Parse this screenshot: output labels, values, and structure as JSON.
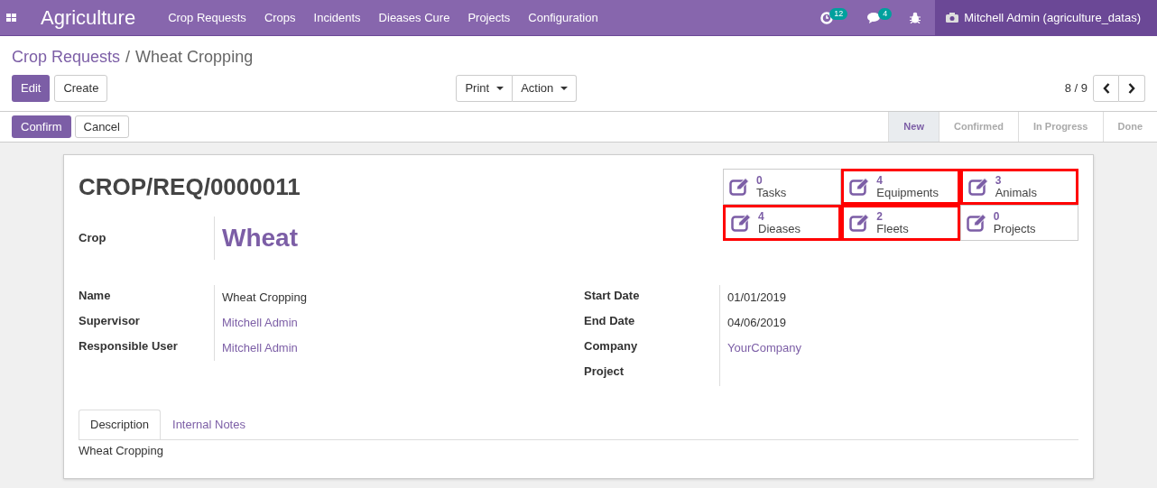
{
  "navbar": {
    "app_name": "Agriculture",
    "menu": [
      "Crop Requests",
      "Crops",
      "Incidents",
      "Dieases Cure",
      "Projects",
      "Configuration"
    ],
    "activity_count": "12",
    "message_count": "4",
    "user": "Mitchell Admin (agriculture_datas)"
  },
  "breadcrumb": {
    "parent": "Crop Requests",
    "separator": "/",
    "current": "Wheat Cropping"
  },
  "buttons": {
    "edit": "Edit",
    "create": "Create",
    "print": "Print",
    "action": "Action",
    "confirm": "Confirm",
    "cancel": "Cancel"
  },
  "pager": "8 / 9",
  "stages": [
    {
      "label": "New",
      "selected": true
    },
    {
      "label": "Confirmed",
      "selected": false
    },
    {
      "label": "In Progress",
      "selected": false
    },
    {
      "label": "Done",
      "selected": false
    }
  ],
  "record": {
    "reference": "CROP/REQ/0000011",
    "crop_label": "Crop",
    "crop_value": "Wheat"
  },
  "smart_buttons": [
    {
      "count": "0",
      "label": "Tasks",
      "highlighted": false
    },
    {
      "count": "4",
      "label": "Equipments",
      "highlighted": true
    },
    {
      "count": "3",
      "label": "Animals",
      "highlighted": true
    },
    {
      "count": "4",
      "label": "Dieases",
      "highlighted": true
    },
    {
      "count": "2",
      "label": "Fleets",
      "highlighted": true
    },
    {
      "count": "0",
      "label": "Projects",
      "highlighted": false
    }
  ],
  "left_fields": [
    {
      "label": "Name",
      "value": "Wheat Cropping",
      "kind": "text"
    },
    {
      "label": "Supervisor",
      "value": "Mitchell Admin",
      "kind": "link"
    },
    {
      "label": "Responsible User",
      "value": "Mitchell Admin",
      "kind": "link"
    }
  ],
  "right_fields": [
    {
      "label": "Start Date",
      "value": "01/01/2019",
      "kind": "text"
    },
    {
      "label": "End Date",
      "value": "04/06/2019",
      "kind": "text"
    },
    {
      "label": "Company",
      "value": "YourCompany",
      "kind": "link"
    },
    {
      "label": "Project"
    }
  ],
  "tabs": [
    {
      "label": "Description",
      "selected": true
    },
    {
      "label": "Internal Notes",
      "selected": false
    }
  ],
  "tab_content": "Wheat Cropping"
}
